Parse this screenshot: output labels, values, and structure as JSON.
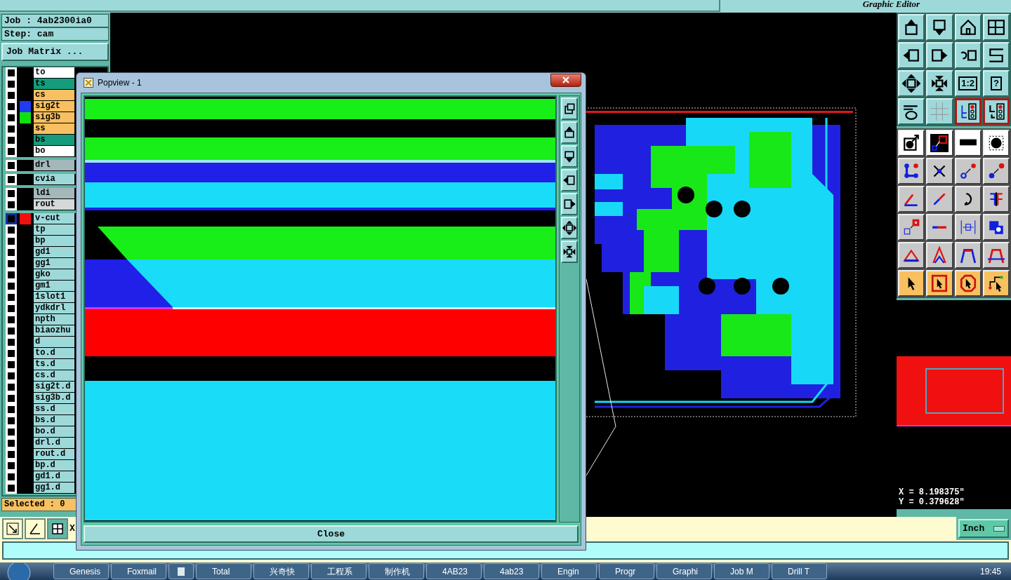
{
  "app": {
    "subtitle": "Graphic Editor"
  },
  "job": {
    "job_label": "Job : 4ab2300ia0",
    "step_label": "Step: cam",
    "matrix_button": "Job Matrix ..."
  },
  "layer_groups": [
    [
      {
        "name": "to",
        "kind": "silk",
        "active": false
      },
      {
        "name": "ts",
        "kind": "mask",
        "active": false
      },
      {
        "name": "cs",
        "kind": "signal",
        "active": false
      },
      {
        "name": "sig2t",
        "kind": "signal",
        "active": false,
        "color": "#1e3cf0"
      },
      {
        "name": "sig3b",
        "kind": "signal",
        "active": false,
        "color": "#10e010"
      },
      {
        "name": "ss",
        "kind": "signal",
        "active": false
      },
      {
        "name": "bs",
        "kind": "mask",
        "active": false
      },
      {
        "name": "bo",
        "kind": "silk",
        "active": false
      }
    ],
    [
      {
        "name": "drl",
        "kind": "drill",
        "active": false
      }
    ],
    [
      {
        "name": "cvia",
        "kind": "misc",
        "active": false
      }
    ],
    [
      {
        "name": "ldi",
        "kind": "drill",
        "active": false
      },
      {
        "name": "rout",
        "kind": "rout",
        "active": false
      }
    ],
    [
      {
        "name": "v-cut",
        "kind": "misc",
        "active": true,
        "color": "#f01010"
      },
      {
        "name": "tp",
        "kind": "misc",
        "active": false
      },
      {
        "name": "bp",
        "kind": "misc",
        "active": false
      },
      {
        "name": "gd1",
        "kind": "misc",
        "active": false
      },
      {
        "name": "gg1",
        "kind": "misc",
        "active": false
      },
      {
        "name": "gko",
        "kind": "misc",
        "active": false
      },
      {
        "name": "gm1",
        "kind": "misc",
        "active": false
      },
      {
        "name": "1slot1",
        "kind": "misc",
        "active": false
      },
      {
        "name": "ydkdrl",
        "kind": "misc",
        "active": false
      },
      {
        "name": "npth",
        "kind": "misc",
        "active": false
      },
      {
        "name": "biaozhu",
        "kind": "misc",
        "active": false
      },
      {
        "name": "d",
        "kind": "misc",
        "active": false
      },
      {
        "name": "to.d",
        "kind": "misc",
        "active": false
      },
      {
        "name": "ts.d",
        "kind": "misc",
        "active": false
      },
      {
        "name": "cs.d",
        "kind": "misc",
        "active": false
      },
      {
        "name": "sig2t.d",
        "kind": "misc",
        "active": false
      },
      {
        "name": "sig3b.d",
        "kind": "misc",
        "active": false
      },
      {
        "name": "ss.d",
        "kind": "misc",
        "active": false
      },
      {
        "name": "bs.d",
        "kind": "misc",
        "active": false
      },
      {
        "name": "bo.d",
        "kind": "misc",
        "active": false
      },
      {
        "name": "drl.d",
        "kind": "misc",
        "active": false
      },
      {
        "name": "rout.d",
        "kind": "misc",
        "active": false
      },
      {
        "name": "bp.d",
        "kind": "misc",
        "active": false
      },
      {
        "name": "gd1.d",
        "kind": "misc",
        "active": false
      },
      {
        "name": "gg1.d",
        "kind": "misc",
        "active": false
      }
    ]
  ],
  "selected_count": "Selected : 0",
  "view_tools": [
    {
      "on": false
    },
    {
      "on": false
    },
    {
      "on": false
    },
    {
      "on": false
    },
    {
      "on": false
    },
    {
      "on": false
    },
    {
      "on": false
    },
    {
      "on": false
    },
    {
      "on": false
    },
    {
      "on": false
    },
    {
      "on": false,
      "label": "1:2"
    },
    {
      "on": false,
      "label": "?"
    },
    {
      "on": false
    },
    {
      "on": false
    },
    {
      "on": true
    },
    {
      "on": true
    }
  ],
  "popview": {
    "title": "Popview - 1",
    "close_button": "Close"
  },
  "bottom": {
    "axis_label": "X",
    "units_button": "Inch"
  },
  "coordinates": {
    "x": "X = 8.198375\"",
    "y": "Y = 0.379628\""
  },
  "taskbar": {
    "items": [
      {
        "kind": "window",
        "label": "Genesis"
      },
      {
        "kind": "window",
        "label": "Foxmail"
      },
      {
        "kind": "icon"
      },
      {
        "kind": "window",
        "label": "Total"
      },
      {
        "kind": "window",
        "label": "兴奇快"
      },
      {
        "kind": "window",
        "label": "工程系"
      },
      {
        "kind": "window",
        "label": "制作机"
      },
      {
        "kind": "window",
        "label": "4AB23"
      },
      {
        "kind": "window",
        "label": "4ab23"
      },
      {
        "kind": "window",
        "label": "Engin"
      },
      {
        "kind": "window",
        "label": "Progr"
      },
      {
        "kind": "window",
        "label": "Graphi"
      },
      {
        "kind": "window",
        "label": "Job M"
      },
      {
        "kind": "window",
        "label": "Drill T"
      }
    ],
    "clock": "19:45"
  }
}
